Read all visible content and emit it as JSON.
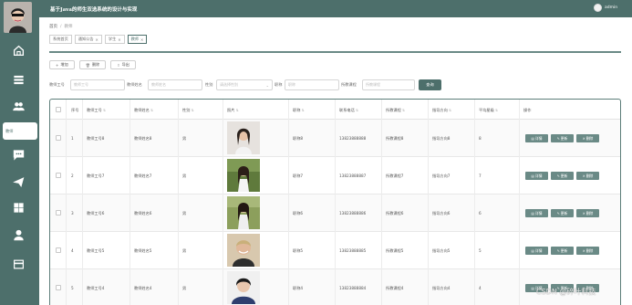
{
  "header": {
    "title": "基于Java的师生双选系统的设计与实现",
    "username": "admin"
  },
  "sidebar": {
    "active_label": "教师"
  },
  "breadcrumb": {
    "home": "首页",
    "current": "教师"
  },
  "tabs": [
    {
      "label": "系统首页",
      "closable": false
    },
    {
      "label": "通知公告",
      "closable": true
    },
    {
      "label": "学生",
      "closable": true
    },
    {
      "label": "教师",
      "closable": true
    }
  ],
  "actions": {
    "add": "增加",
    "delete": "删除",
    "export": "导出"
  },
  "search": {
    "label_no": "教师工号",
    "ph_no": "教师工号",
    "label_name": "教师姓名",
    "ph_name": "教师姓名",
    "label_gender": "性别",
    "ph_gender": "请选择性别",
    "label_title": "职称",
    "ph_title": "职称",
    "label_course": "所教课程",
    "ph_course": "所教课程",
    "button": "查询"
  },
  "table": {
    "columns": [
      "序号",
      "教师工号",
      "教师姓名",
      "性别",
      "照片",
      "职称",
      "联系电话",
      "所教课程",
      "指导方向",
      "平均星级",
      "操作"
    ],
    "row_buttons": {
      "detail": "详情",
      "edit": "更新",
      "delete": "删除"
    },
    "rows": [
      {
        "idx": "1",
        "no": "教师工号8",
        "name": "教师姓名8",
        "gender": "男",
        "title": "职称8",
        "phone": "13823888888",
        "course": "所教课程8",
        "direction": "指导方向8",
        "stars": "8"
      },
      {
        "idx": "2",
        "no": "教师工号7",
        "name": "教师姓名7",
        "gender": "男",
        "title": "职称7",
        "phone": "13823888887",
        "course": "所教课程7",
        "direction": "指导方向7",
        "stars": "7"
      },
      {
        "idx": "3",
        "no": "教师工号6",
        "name": "教师姓名6",
        "gender": "男",
        "title": "职称6",
        "phone": "13823888886",
        "course": "所教课程6",
        "direction": "指导方向6",
        "stars": "6"
      },
      {
        "idx": "4",
        "no": "教师工号5",
        "name": "教师姓名5",
        "gender": "男",
        "title": "职称5",
        "phone": "13823888885",
        "course": "所教课程5",
        "direction": "指导方向5",
        "stars": "5"
      },
      {
        "idx": "5",
        "no": "教师工号4",
        "name": "教师姓名4",
        "gender": "男",
        "title": "职称4",
        "phone": "13823888884",
        "course": "所教课程4",
        "direction": "指导方向4",
        "stars": "4"
      }
    ]
  },
  "watermark": "CSDN @碎叶科技",
  "colors": {
    "primary": "#4d6f6b",
    "button": "#6a8a86"
  }
}
